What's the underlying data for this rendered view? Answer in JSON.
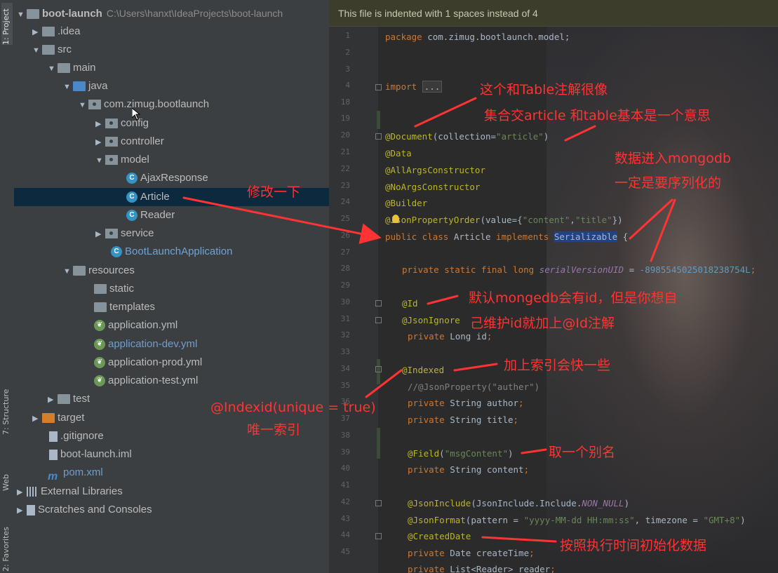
{
  "toolstrip": {
    "tabs": [
      "1: Project",
      "7: Structure",
      "Web",
      "2: Favorites"
    ]
  },
  "project": {
    "root_name": "boot-launch",
    "root_path": "C:\\Users\\hanxt\\IdeaProjects\\boot-launch",
    "nodes": [
      "boot-launch",
      ".idea",
      "src",
      "main",
      "java",
      "com.zimug.bootlaunch",
      "config",
      "controller",
      "model",
      "AjaxResponse",
      "Article",
      "Reader",
      "service",
      "BootLaunchApplication",
      "resources",
      "static",
      "templates",
      "application.yml",
      "application-dev.yml",
      "application-prod.yml",
      "application-test.yml",
      "test",
      "target",
      ".gitignore",
      "boot-launch.iml",
      "pom.xml",
      "External Libraries",
      "Scratches and Consoles"
    ],
    "class_letter": "C"
  },
  "editor": {
    "banner": "This file is indented with 1 spaces instead of 4",
    "line_numbers": [
      "1",
      "2",
      "3",
      "4",
      "18",
      "19",
      "20",
      "21",
      "22",
      "23",
      "24",
      "25",
      "26",
      "27",
      "28",
      "29",
      "30",
      "31",
      "32",
      "33",
      "34",
      "35",
      "36",
      "37",
      "38",
      "39",
      "40",
      "41",
      "42",
      "43",
      "44",
      "45"
    ],
    "code": {
      "l1_kw": "package",
      "l1_rest": " com.zimug.bootlaunch.model;",
      "l4_kw": "import",
      "l4_fold": "...",
      "l20_an": "@Document",
      "l20_a": "(collection=",
      "l20_s": "\"article\"",
      "l20_b": ")",
      "l21": "@Data",
      "l22": "@AllArgsConstructor",
      "l23": "@NoArgsConstructor",
      "l24": "@Builder",
      "l25_an": "@JsonPropertyOrder",
      "l25_a": "(value={",
      "l25_s1": "\"content\"",
      "l25_c": ",",
      "l25_s2": "\"title\"",
      "l25_b": "})",
      "l26_kw": "public class",
      "l26_a": " Article ",
      "l26_kw2": "implements",
      "l26_hl": "Serializable",
      "l26_b": " {",
      "l28_kw": "private static final long ",
      "l28_it": "serialVersionUID",
      "l28_a": " = ",
      "l28_num": "-8985545025018238754L",
      "l30": "@Id",
      "l31": "@JsonIgnore",
      "l32_kw": "private",
      "l32_a": " Long id",
      "l34": "@Indexed",
      "l35_c": "//@JsonProperty(\"auther\")",
      "l36_kw": "private",
      "l36_a": " String author",
      "l37_kw": "private",
      "l37_a": " String title",
      "l39_an": "@Field",
      "l39_a": "(",
      "l39_s": "\"msgContent\"",
      "l39_b": ")",
      "l40_kw": "private",
      "l40_a": " String content",
      "l42_an": "@JsonInclude",
      "l42_a": "(JsonInclude.Include.",
      "l42_it": "NON_NULL",
      "l42_b": ")",
      "l43_an": "@JsonFormat",
      "l43_a": "(pattern = ",
      "l43_s": "\"yyyy-MM-dd HH:mm:ss\"",
      "l43_c": ", timezone = ",
      "l43_s2": "\"GMT+8\"",
      "l43_b": ")",
      "l44": "@CreatedDate",
      "l45_kw": "private",
      "l45_a": " Date createTime",
      "l46_kw": "private",
      "l46_a": " List<Reader> reader",
      "semi": ";"
    }
  },
  "annotations": {
    "n1": "这个和Table注解很像",
    "n2": "集合交article   和table基本是一个意思",
    "n3": "数据进入mongodb",
    "n4": "一定是要序列化的",
    "n5": "修改一下",
    "n6": "默认mongedb会有id，但是你想自",
    "n7": "己维护id就加上@Id注解",
    "n8": "加上索引会快一些",
    "n9": "@Indexid(unique = true)",
    "n10": "唯一索引",
    "n11": "取一个别名",
    "n12": "按照执行时间初始化数据"
  },
  "colors": {
    "annotation": "#ff3333",
    "selection": "#0d293e",
    "keyword": "#cc7832",
    "annotation_code": "#bbb529",
    "string": "#6a8759"
  }
}
